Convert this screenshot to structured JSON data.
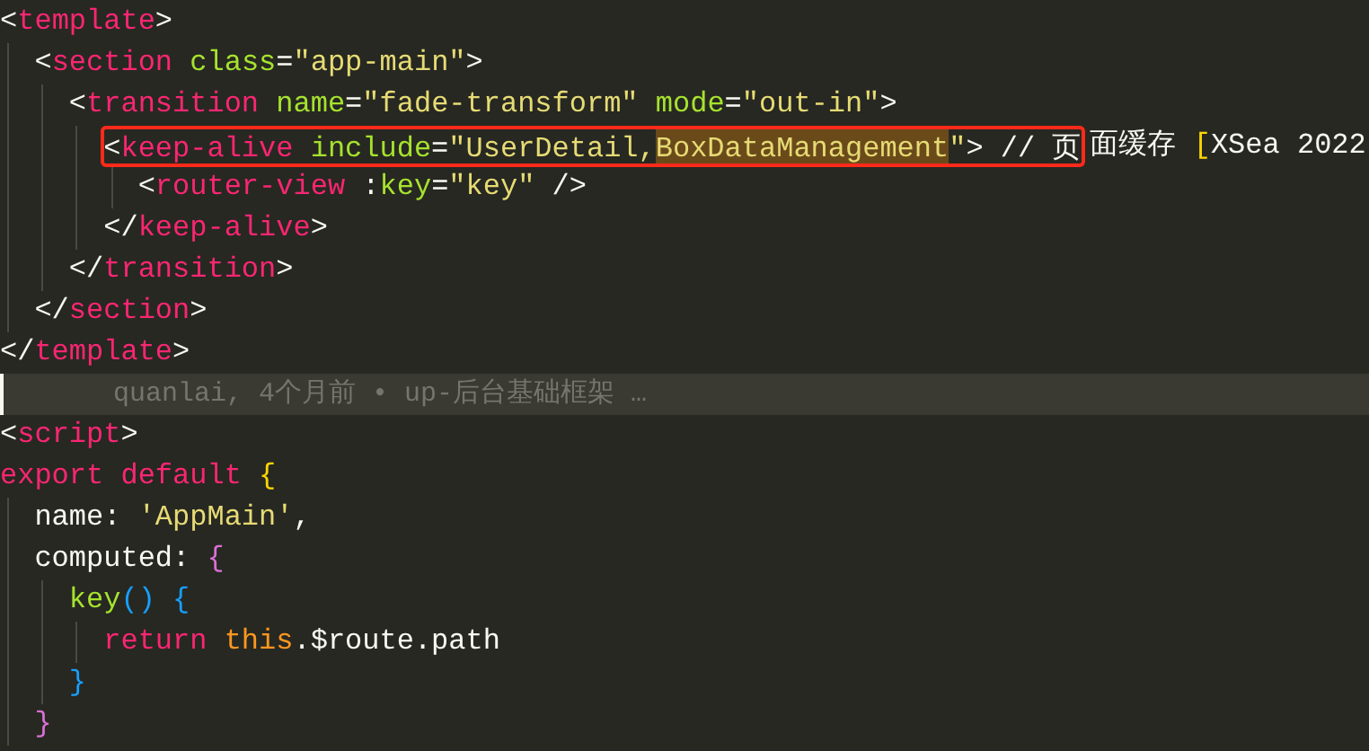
{
  "editor": {
    "lines": [
      {
        "tokens": [
          {
            "kind": "punct",
            "text": "<"
          },
          {
            "kind": "tag",
            "text": "template"
          },
          {
            "kind": "punct",
            "text": ">"
          }
        ],
        "children": [
          {
            "tokens": [
              {
                "kind": "punct",
                "text": "<"
              },
              {
                "kind": "tag",
                "text": "section"
              },
              {
                "kind": "attr",
                "text": " class"
              },
              {
                "kind": "punct",
                "text": "="
              },
              {
                "kind": "string",
                "text": "\"app-main\""
              },
              {
                "kind": "punct",
                "text": ">"
              }
            ],
            "children": [
              {
                "tokens": [
                  {
                    "kind": "punct",
                    "text": "<"
                  },
                  {
                    "kind": "tag",
                    "text": "transition"
                  },
                  {
                    "kind": "attr",
                    "text": " name"
                  },
                  {
                    "kind": "punct",
                    "text": "="
                  },
                  {
                    "kind": "string",
                    "text": "\"fade-transform\""
                  },
                  {
                    "kind": "attr",
                    "text": " mode"
                  },
                  {
                    "kind": "punct",
                    "text": "="
                  },
                  {
                    "kind": "string",
                    "text": "\"out-in\""
                  },
                  {
                    "kind": "punct",
                    "text": ">"
                  }
                ],
                "children": [
                  {
                    "framed": [
                      {
                        "kind": "punct",
                        "text": "<"
                      },
                      {
                        "kind": "tag",
                        "text": "keep-alive"
                      },
                      {
                        "kind": "attr",
                        "text": " include"
                      },
                      {
                        "kind": "punct",
                        "text": "="
                      },
                      {
                        "kind": "string",
                        "text": "\"UserDetail,"
                      },
                      {
                        "kind": "match",
                        "text": "BoxDataManagement"
                      },
                      {
                        "kind": "string",
                        "text": "\""
                      },
                      {
                        "kind": "punct",
                        "text": "> // 页"
                      }
                    ],
                    "tokens": [
                      {
                        "kind": "plain",
                        "text": "面缓存 "
                      },
                      {
                        "kind": "bracket1",
                        "text": "["
                      },
                      {
                        "kind": "plain",
                        "text": "XSea 2022"
                      }
                    ],
                    "children": [
                      {
                        "tokens": [
                          {
                            "kind": "punct",
                            "text": "<"
                          },
                          {
                            "kind": "tag",
                            "text": "router-view"
                          },
                          {
                            "kind": "punct",
                            "text": " :"
                          },
                          {
                            "kind": "attr",
                            "text": "key"
                          },
                          {
                            "kind": "punct",
                            "text": "="
                          },
                          {
                            "kind": "string",
                            "text": "\"key\""
                          },
                          {
                            "kind": "punct",
                            "text": " />"
                          }
                        ]
                      }
                    ]
                  },
                  {
                    "tokens": [
                      {
                        "kind": "punct",
                        "text": "</"
                      },
                      {
                        "kind": "tag",
                        "text": "keep-alive"
                      },
                      {
                        "kind": "punct",
                        "text": ">"
                      }
                    ]
                  }
                ]
              },
              {
                "tokens": [
                  {
                    "kind": "punct",
                    "text": "</"
                  },
                  {
                    "kind": "tag",
                    "text": "transition"
                  },
                  {
                    "kind": "punct",
                    "text": ">"
                  }
                ]
              }
            ]
          },
          {
            "tokens": [
              {
                "kind": "punct",
                "text": "</"
              },
              {
                "kind": "tag",
                "text": "section"
              },
              {
                "kind": "punct",
                "text": ">"
              }
            ]
          }
        ]
      },
      {
        "tokens": [
          {
            "kind": "punct",
            "text": "</"
          },
          {
            "kind": "tag",
            "text": "template"
          },
          {
            "kind": "punct",
            "text": ">"
          }
        ]
      },
      {
        "blame": "quanlai, 4个月前 • up-后台基础框架 …"
      },
      {
        "tokens": [
          {
            "kind": "punct",
            "text": "<"
          },
          {
            "kind": "tag",
            "text": "script"
          },
          {
            "kind": "punct",
            "text": ">"
          }
        ]
      },
      {
        "tokens": [
          {
            "kind": "keyword",
            "text": "export default "
          },
          {
            "kind": "bracket1",
            "text": "{"
          }
        ],
        "children": [
          {
            "tokens": [
              {
                "kind": "plain",
                "text": "name: "
              },
              {
                "kind": "string",
                "text": "'AppMain'"
              },
              {
                "kind": "plain",
                "text": ","
              }
            ]
          },
          {
            "tokens": [
              {
                "kind": "plain",
                "text": "computed: "
              },
              {
                "kind": "bracket2",
                "text": "{"
              }
            ],
            "children": [
              {
                "tokens": [
                  {
                    "kind": "attr",
                    "text": "key"
                  },
                  {
                    "kind": "bracket3",
                    "text": "() {"
                  }
                ],
                "children": [
                  {
                    "tokens": [
                      {
                        "kind": "keyword",
                        "text": "return "
                      },
                      {
                        "kind": "this",
                        "text": "this"
                      },
                      {
                        "kind": "plain",
                        "text": ".$route.path"
                      }
                    ]
                  }
                ]
              },
              {
                "tokens": [
                  {
                    "kind": "bracket3",
                    "text": "}"
                  }
                ]
              }
            ]
          },
          {
            "tokens": [
              {
                "kind": "bracket2",
                "text": "}"
              }
            ]
          }
        ]
      }
    ]
  }
}
